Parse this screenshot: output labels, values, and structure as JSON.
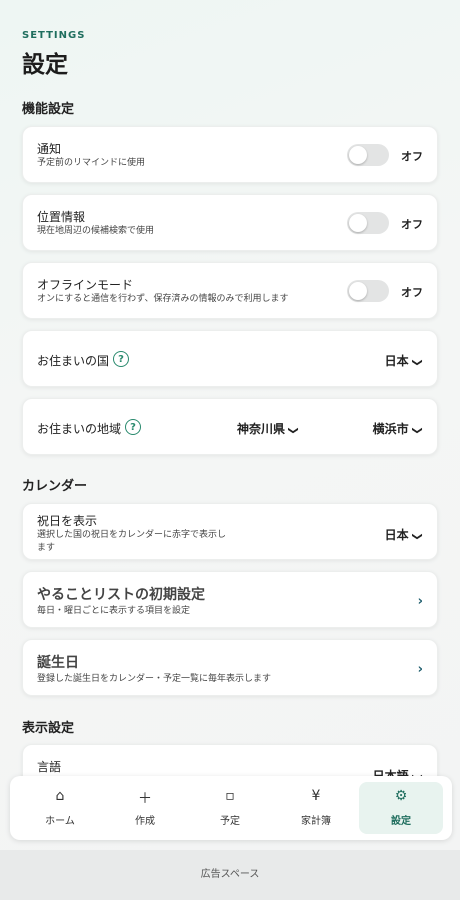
{
  "header": {
    "eyebrow": "SETTINGS",
    "title": "設定"
  },
  "sections": {
    "features": "機能設定",
    "calendar": "カレンダー",
    "display": "表示設定"
  },
  "notify": {
    "title": "通知",
    "sub": "予定前のリマインドに使用",
    "state": "オフ"
  },
  "location": {
    "title": "位置情報",
    "sub": "現在地周辺の候補検索で使用",
    "state": "オフ"
  },
  "offline": {
    "title": "オフラインモード",
    "sub": "オンにすると通信を行わず、保存済みの情報のみで利用します",
    "state": "オフ"
  },
  "country": {
    "title": "お住まいの国",
    "value": "日本",
    "help": "?"
  },
  "region": {
    "title": "お住まいの地域",
    "pref": "神奈川県",
    "city": "横浜市",
    "help": "?"
  },
  "holiday": {
    "title": "祝日を表示",
    "sub1": "選択した国の祝日をカレンダーに赤字で表示し",
    "sub2": "ます",
    "value": "日本"
  },
  "todo": {
    "title": "やることリストの初期設定",
    "sub": "毎日・曜日ごとに表示する項目を設定"
  },
  "birthday": {
    "title": "誕生日",
    "sub": "登録した誕生日をカレンダー・予定一覧に毎年表示します"
  },
  "language": {
    "title": "言語",
    "value": "日本語"
  },
  "tabs": [
    {
      "label": "ホーム",
      "icon": "⌂"
    },
    {
      "label": "作成",
      "icon": "＋"
    },
    {
      "label": "予定",
      "icon": "▫"
    },
    {
      "label": "家計簿",
      "icon": "¥"
    },
    {
      "label": "設定",
      "icon": "⚙"
    }
  ],
  "ad": "広告スペース",
  "colors": {
    "accent": "#1f6e5e",
    "toggle_off": "#e3e4e4"
  }
}
